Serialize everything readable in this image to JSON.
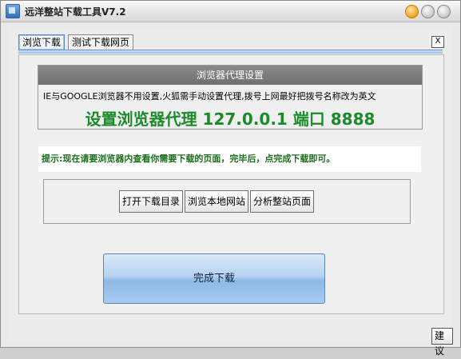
{
  "window": {
    "title": "远洋整站下载工具V7.2"
  },
  "tabs": [
    {
      "label": "浏览下载",
      "active": true
    },
    {
      "label": "测试下载网页",
      "active": false
    }
  ],
  "tab_close_label": "X",
  "proxy": {
    "header": "浏览器代理设置",
    "note": "IE与GOOGLE浏览器不用设置,火狐需手动设置代理,拨号上网最好把拨号名称改为英文",
    "setting": "设置浏览器代理 127.0.0.1 端口 8888"
  },
  "hint": "提示:现在请要浏览器内查看你需要下载的页面，完毕后，点完成下载即可。",
  "buttons": {
    "open_dir": "打开下载目录",
    "browse_local": "浏览本地网站",
    "analyze": "分析整站页面",
    "finish": "完成下载",
    "suggest": "建议"
  },
  "colors": {
    "accent_green": "#1a8a2a",
    "tab_blue": "#5b86c7"
  }
}
